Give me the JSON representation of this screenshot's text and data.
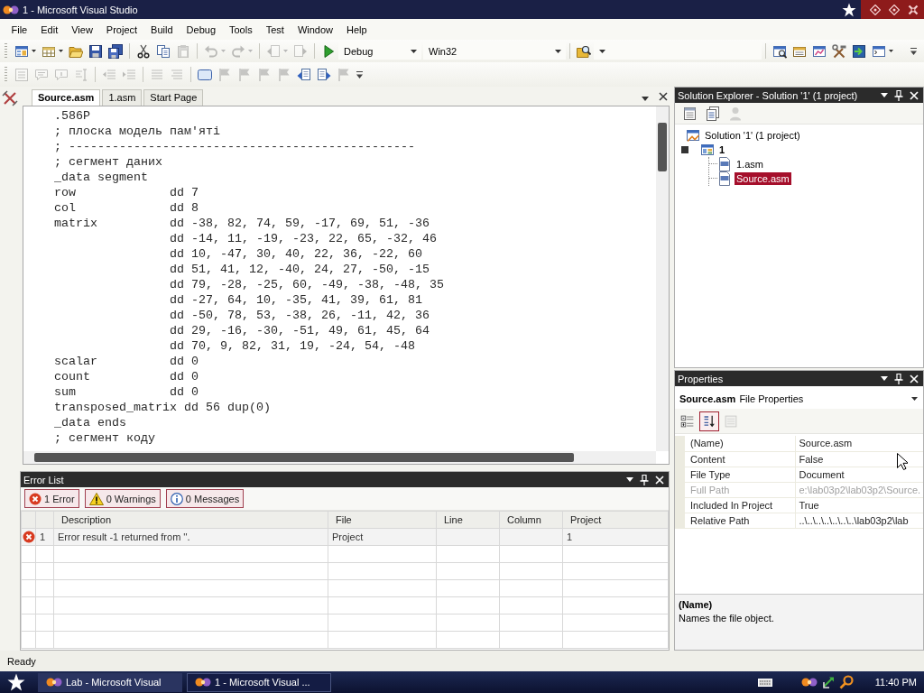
{
  "window": {
    "title": "1 - Microsoft Visual Studio"
  },
  "menu": [
    "File",
    "Edit",
    "View",
    "Project",
    "Build",
    "Debug",
    "Tools",
    "Test",
    "Window",
    "Help"
  ],
  "toolbar_standard": [
    {
      "kind": "project",
      "disabled": false,
      "dropdown": true
    },
    {
      "kind": "additem",
      "disabled": false,
      "dropdown": true
    },
    {
      "kind": "open",
      "disabled": false,
      "dropdown": false
    },
    {
      "kind": "save",
      "disabled": false,
      "dropdown": false
    },
    {
      "kind": "saveall",
      "disabled": false,
      "dropdown": false
    },
    {
      "kind": "separator"
    },
    {
      "kind": "cut",
      "disabled": false,
      "dropdown": false
    },
    {
      "kind": "copy",
      "disabled": false,
      "dropdown": false
    },
    {
      "kind": "paste",
      "disabled": true,
      "dropdown": false
    },
    {
      "kind": "separator"
    },
    {
      "kind": "undo",
      "disabled": true,
      "dropdown": true
    },
    {
      "kind": "redo",
      "disabled": true,
      "dropdown": true
    },
    {
      "kind": "separator"
    },
    {
      "kind": "back",
      "disabled": true,
      "dropdown": true
    },
    {
      "kind": "forward",
      "disabled": true,
      "dropdown": false
    },
    {
      "kind": "separator"
    },
    {
      "kind": "start",
      "disabled": false,
      "dropdown": false
    },
    {
      "kind": "combo",
      "value": "Debug"
    },
    {
      "kind": "combo",
      "value": "Win32"
    },
    {
      "kind": "separator"
    },
    {
      "kind": "find",
      "disabled": false,
      "dropdown": false
    },
    {
      "kind": "combo"
    },
    {
      "kind": "separator"
    },
    {
      "kind": "explorer",
      "disabled": false,
      "dropdown": false
    },
    {
      "kind": "properties",
      "disabled": false,
      "dropdown": false
    },
    {
      "kind": "objectbrowser",
      "disabled": false,
      "dropdown": false
    },
    {
      "kind": "toolbox",
      "disabled": false,
      "dropdown": false
    },
    {
      "kind": "startpage",
      "disabled": false,
      "dropdown": false
    },
    {
      "kind": "command",
      "disabled": false,
      "dropdown": true
    },
    {
      "kind": "overflow"
    }
  ],
  "toolbar_text_editor": [
    {
      "kind": "members",
      "disabled": true,
      "dropdown": false
    },
    {
      "kind": "paraminfo",
      "disabled": true,
      "dropdown": false
    },
    {
      "kind": "quickinfo",
      "disabled": true,
      "dropdown": false
    },
    {
      "kind": "wordcomplete",
      "disabled": true,
      "dropdown": false
    },
    {
      "kind": "separator"
    },
    {
      "kind": "outdent",
      "disabled": true,
      "dropdown": false
    },
    {
      "kind": "indent",
      "disabled": true,
      "dropdown": false
    },
    {
      "kind": "separator"
    },
    {
      "kind": "comment",
      "disabled": true,
      "dropdown": false
    },
    {
      "kind": "uncomment",
      "disabled": true,
      "dropdown": false
    },
    {
      "kind": "separator"
    },
    {
      "kind": "box",
      "disabled": false,
      "dropdown": false
    },
    {
      "kind": "bookmark",
      "disabled": true,
      "dropdown": false
    },
    {
      "kind": "bookmark",
      "disabled": true,
      "dropdown": false
    },
    {
      "kind": "bookmark",
      "disabled": true,
      "dropdown": false
    },
    {
      "kind": "bookmark",
      "disabled": true,
      "dropdown": false
    },
    {
      "kind": "prevbookmark",
      "disabled": false,
      "dropdown": false
    },
    {
      "kind": "nextbookmark",
      "disabled": false,
      "dropdown": false
    },
    {
      "kind": "bookmark",
      "disabled": true,
      "dropdown": false
    },
    {
      "kind": "overflow"
    }
  ],
  "document_tabs": [
    {
      "label": "Source.asm",
      "selected": true
    },
    {
      "label": "1.asm",
      "selected": false
    },
    {
      "label": "Start Page",
      "selected": false
    }
  ],
  "editor": {
    "lines": [
      {
        "kind": "plain",
        "code": ".586P"
      },
      {
        "kind": "plain",
        "code": "; плоска модель пам'яті"
      },
      {
        "kind": "plain",
        "code": "; ------------------------------------------------"
      },
      {
        "kind": "plain",
        "code": "; сегмент даних"
      },
      {
        "kind": "plain",
        "code": "_data segment"
      },
      {
        "kind": "data",
        "label": "row",
        "code": "dd 7"
      },
      {
        "kind": "data",
        "label": "col",
        "code": "dd 8"
      },
      {
        "kind": "data",
        "label": "matrix",
        "code": "dd -38, 82, 74, 59, -17, 69, 51, -36"
      },
      {
        "kind": "continued",
        "code": "dd -14, 11, -19, -23, 22, 65, -32, 46"
      },
      {
        "kind": "continued",
        "code": "dd 10, -47, 30, 40, 22, 36, -22, 60"
      },
      {
        "kind": "continued",
        "code": "dd 51, 41, 12, -40, 24, 27, -50, -15"
      },
      {
        "kind": "continued",
        "code": "dd 79, -28, -25, 60, -49, -38, -48, 35"
      },
      {
        "kind": "continued",
        "code": "dd -27, 64, 10, -35, 41, 39, 61, 81"
      },
      {
        "kind": "continued",
        "code": "dd -50, 78, 53, -38, 26, -11, 42, 36"
      },
      {
        "kind": "continued",
        "code": "dd 29, -16, -30, -51, 49, 61, 45, 64"
      },
      {
        "kind": "continued",
        "code": "dd 70, 9, 82, 31, 19, -24, 54, -48"
      },
      {
        "kind": "data",
        "label": "scalar",
        "code": "dd 0"
      },
      {
        "kind": "data",
        "label": "count",
        "code": "dd 0"
      },
      {
        "kind": "data",
        "label": "sum",
        "code": "dd 0"
      },
      {
        "kind": "data",
        "label": "transposed_matrix",
        "code": "dd 56 dup(0)"
      },
      {
        "kind": "plain",
        "code": "_data ends"
      },
      {
        "kind": "plain",
        "code": "; сегмент коду"
      }
    ]
  },
  "error_list": {
    "title": "Error List",
    "filters": [
      {
        "kind": "error",
        "label": "1 Error",
        "selected": true
      },
      {
        "kind": "warning",
        "label": "0 Warnings",
        "selected": true
      },
      {
        "kind": "message",
        "label": "0 Messages",
        "selected": true
      }
    ],
    "columns": [
      "Description",
      "File",
      "Line",
      "Column",
      "Project"
    ],
    "rows": [
      {
        "kind": "error",
        "number": "1",
        "description": "Error result -1 returned from ''.",
        "file": "Project",
        "project": "1"
      }
    ]
  },
  "solution_explorer": {
    "title": "Solution Explorer - Solution '1' (1 project)",
    "tools": [
      {
        "kind": "sheet",
        "disabled": false
      },
      {
        "kind": "files",
        "disabled": false
      },
      {
        "kind": "person",
        "disabled": true
      }
    ],
    "tree": [
      {
        "kind": "solution",
        "label": "Solution '1' (1 project)",
        "selected": false,
        "children": [
          {
            "kind": "project",
            "label": "1",
            "selected": false,
            "expanded": true,
            "children": [
              {
                "kind": "file",
                "label": "1.asm",
                "selected": false
              },
              {
                "kind": "file",
                "label": "Source.asm",
                "selected": true
              }
            ]
          }
        ]
      }
    ]
  },
  "properties": {
    "title": "Properties",
    "object_name": "Source.asm",
    "object_type": "File Properties",
    "tools": [
      {
        "kind": "categorized",
        "selected": false,
        "disabled": false
      },
      {
        "kind": "alphabetical",
        "selected": true,
        "disabled": false
      },
      {
        "kind": "pages",
        "selected": false,
        "disabled": true
      }
    ],
    "rows": [
      {
        "name": "(Name)",
        "value": "Source.asm",
        "disabled": false
      },
      {
        "name": "Content",
        "value": "False",
        "disabled": false
      },
      {
        "name": "File Type",
        "value": "Document",
        "disabled": false
      },
      {
        "name": "Full Path",
        "value": "e:\\lab03p2\\lab03p2\\Source.",
        "disabled": true
      },
      {
        "name": "Included In Project",
        "value": "True",
        "disabled": false
      },
      {
        "name": "Relative Path",
        "value": "..\\..\\..\\..\\..\\..\\..\\lab03p2\\lab",
        "disabled": false
      }
    ],
    "help_title": "(Name)",
    "help_text": "Names the file object."
  },
  "status_bar": {
    "text": "Ready"
  },
  "taskbar": {
    "tasks": [
      {
        "label": "Lab - Microsoft Visual",
        "selected": false
      },
      {
        "label": "1 - Microsoft Visual ...",
        "selected": true
      }
    ],
    "clock": "11:40 PM"
  }
}
